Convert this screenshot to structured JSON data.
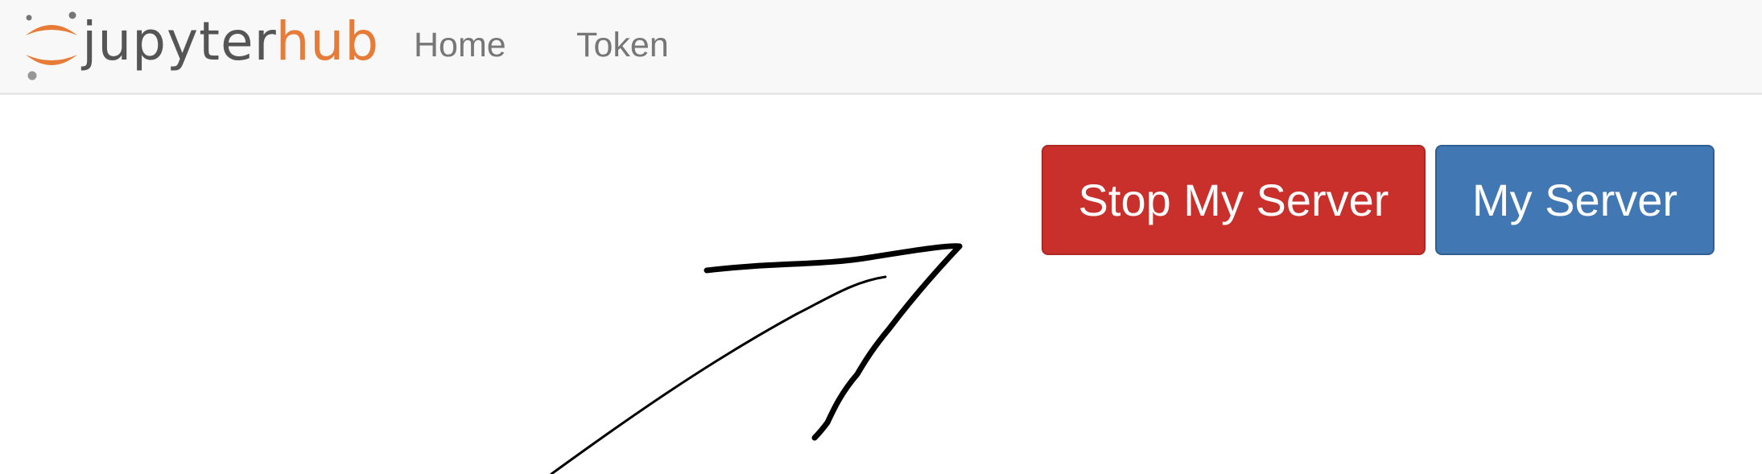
{
  "navbar": {
    "logo_prefix": "jupyter",
    "logo_suffix": "hub",
    "links": [
      {
        "label": "Home"
      },
      {
        "label": "Token"
      }
    ]
  },
  "actions": {
    "stop_server_label": "Stop My Server",
    "my_server_label": "My Server"
  },
  "colors": {
    "brand_orange": "#e77b38",
    "danger": "#c9302c",
    "primary": "#4177b2",
    "navbar_bg": "#f8f8f8"
  },
  "annotation": {
    "icon": "hand-drawn-arrow-icon"
  }
}
